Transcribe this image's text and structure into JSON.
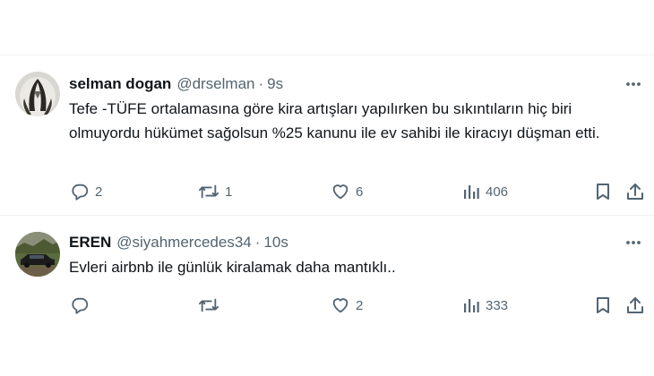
{
  "tweets": [
    {
      "author_name": "selman dogan",
      "handle": "@drselman",
      "separator": "·",
      "time": "9s",
      "text": "Tefe -TÜFE ortalamasına göre kira artışları yapılırken bu sıkıntıların hiç biri olmuyordu hükümet sağolsun %25 kanunu ile ev sahibi ile kiracıyı düşman etti.",
      "replies": "2",
      "reposts": "1",
      "likes": "6",
      "views": "406",
      "icons": [
        "more-icon",
        "reply-icon",
        "repost-icon",
        "like-icon",
        "views-icon",
        "bookmark-icon",
        "share-icon"
      ]
    },
    {
      "author_name": "EREN",
      "handle": "@siyahmercedes34",
      "separator": "·",
      "time": "10s",
      "text": "Evleri airbnb ile günlük kiralamak daha mantıklı..",
      "replies": "",
      "reposts": "",
      "likes": "2",
      "views": "333",
      "icons": [
        "more-icon",
        "reply-icon",
        "repost-icon",
        "like-icon",
        "views-icon",
        "bookmark-icon",
        "share-icon"
      ]
    }
  ],
  "colors": {
    "text": "#0f1419",
    "secondary": "#536471",
    "divider": "#eff3f4",
    "background": "#ffffff"
  }
}
